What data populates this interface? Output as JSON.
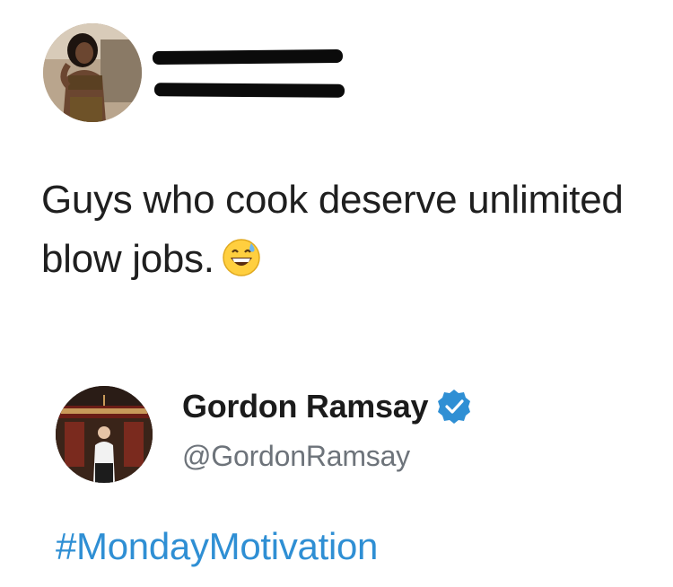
{
  "tweet1": {
    "avatar_icon": "user-avatar-photo",
    "redacted_lines": 2,
    "text_line1": "Guys who cook deserve unlimited",
    "text_line2": "blow jobs.",
    "emoji": "grinning-face-with-sweat-emoji"
  },
  "tweet2": {
    "avatar_icon": "gordon-ramsay-avatar-photo",
    "display_name": "Gordon Ramsay",
    "verified_icon": "verified-badge-icon",
    "handle": "@GordonRamsay",
    "text": "#MondayMotivation",
    "hashtag_color": "#2f8fd4"
  },
  "colors": {
    "text": "#1f1f1f",
    "handle": "#6d737a",
    "verified": "#2f8fd4"
  }
}
